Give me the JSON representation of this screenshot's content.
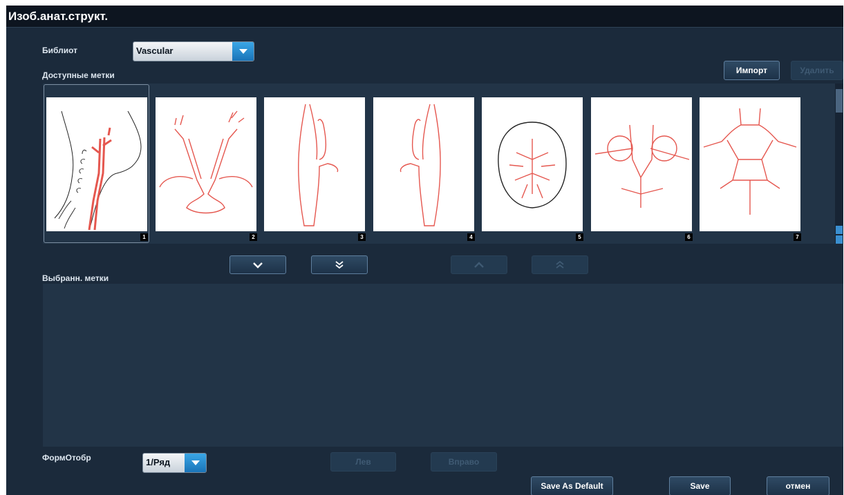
{
  "window": {
    "title": "Изоб.анат.структ."
  },
  "library": {
    "label": "Библиот",
    "value": "Vascular"
  },
  "available": {
    "label": "Доступные метки",
    "thumbnails": [
      {
        "number": "1",
        "name": "neck-carotid"
      },
      {
        "number": "2",
        "name": "aortic-arch-branches"
      },
      {
        "number": "3",
        "name": "vessel-branch-left"
      },
      {
        "number": "4",
        "name": "vessel-branch-right"
      },
      {
        "number": "5",
        "name": "brain-vessels"
      },
      {
        "number": "6",
        "name": "circle-of-willis-loops"
      },
      {
        "number": "7",
        "name": "circle-of-willis"
      }
    ]
  },
  "buttons": {
    "import": "Импорт",
    "delete": "Удалить",
    "left": "Лев",
    "right": "Вправо",
    "save_default": "Save As Default",
    "save": "Save",
    "cancel": "отмен"
  },
  "selected": {
    "label": "Выбранн. метки"
  },
  "display_format": {
    "label": "ФормОтобр",
    "value": "1/Ряд"
  },
  "colors": {
    "accent": "#2a8ed6",
    "vessel": "#e5574f",
    "background": "#1b2a3b"
  },
  "icons": {
    "dropdown": "chevron-down-icon",
    "move_down": "chevron-down-icon",
    "move_all_down": "double-chevron-down-icon",
    "move_up": "chevron-up-icon",
    "move_all_up": "double-chevron-up-icon"
  }
}
